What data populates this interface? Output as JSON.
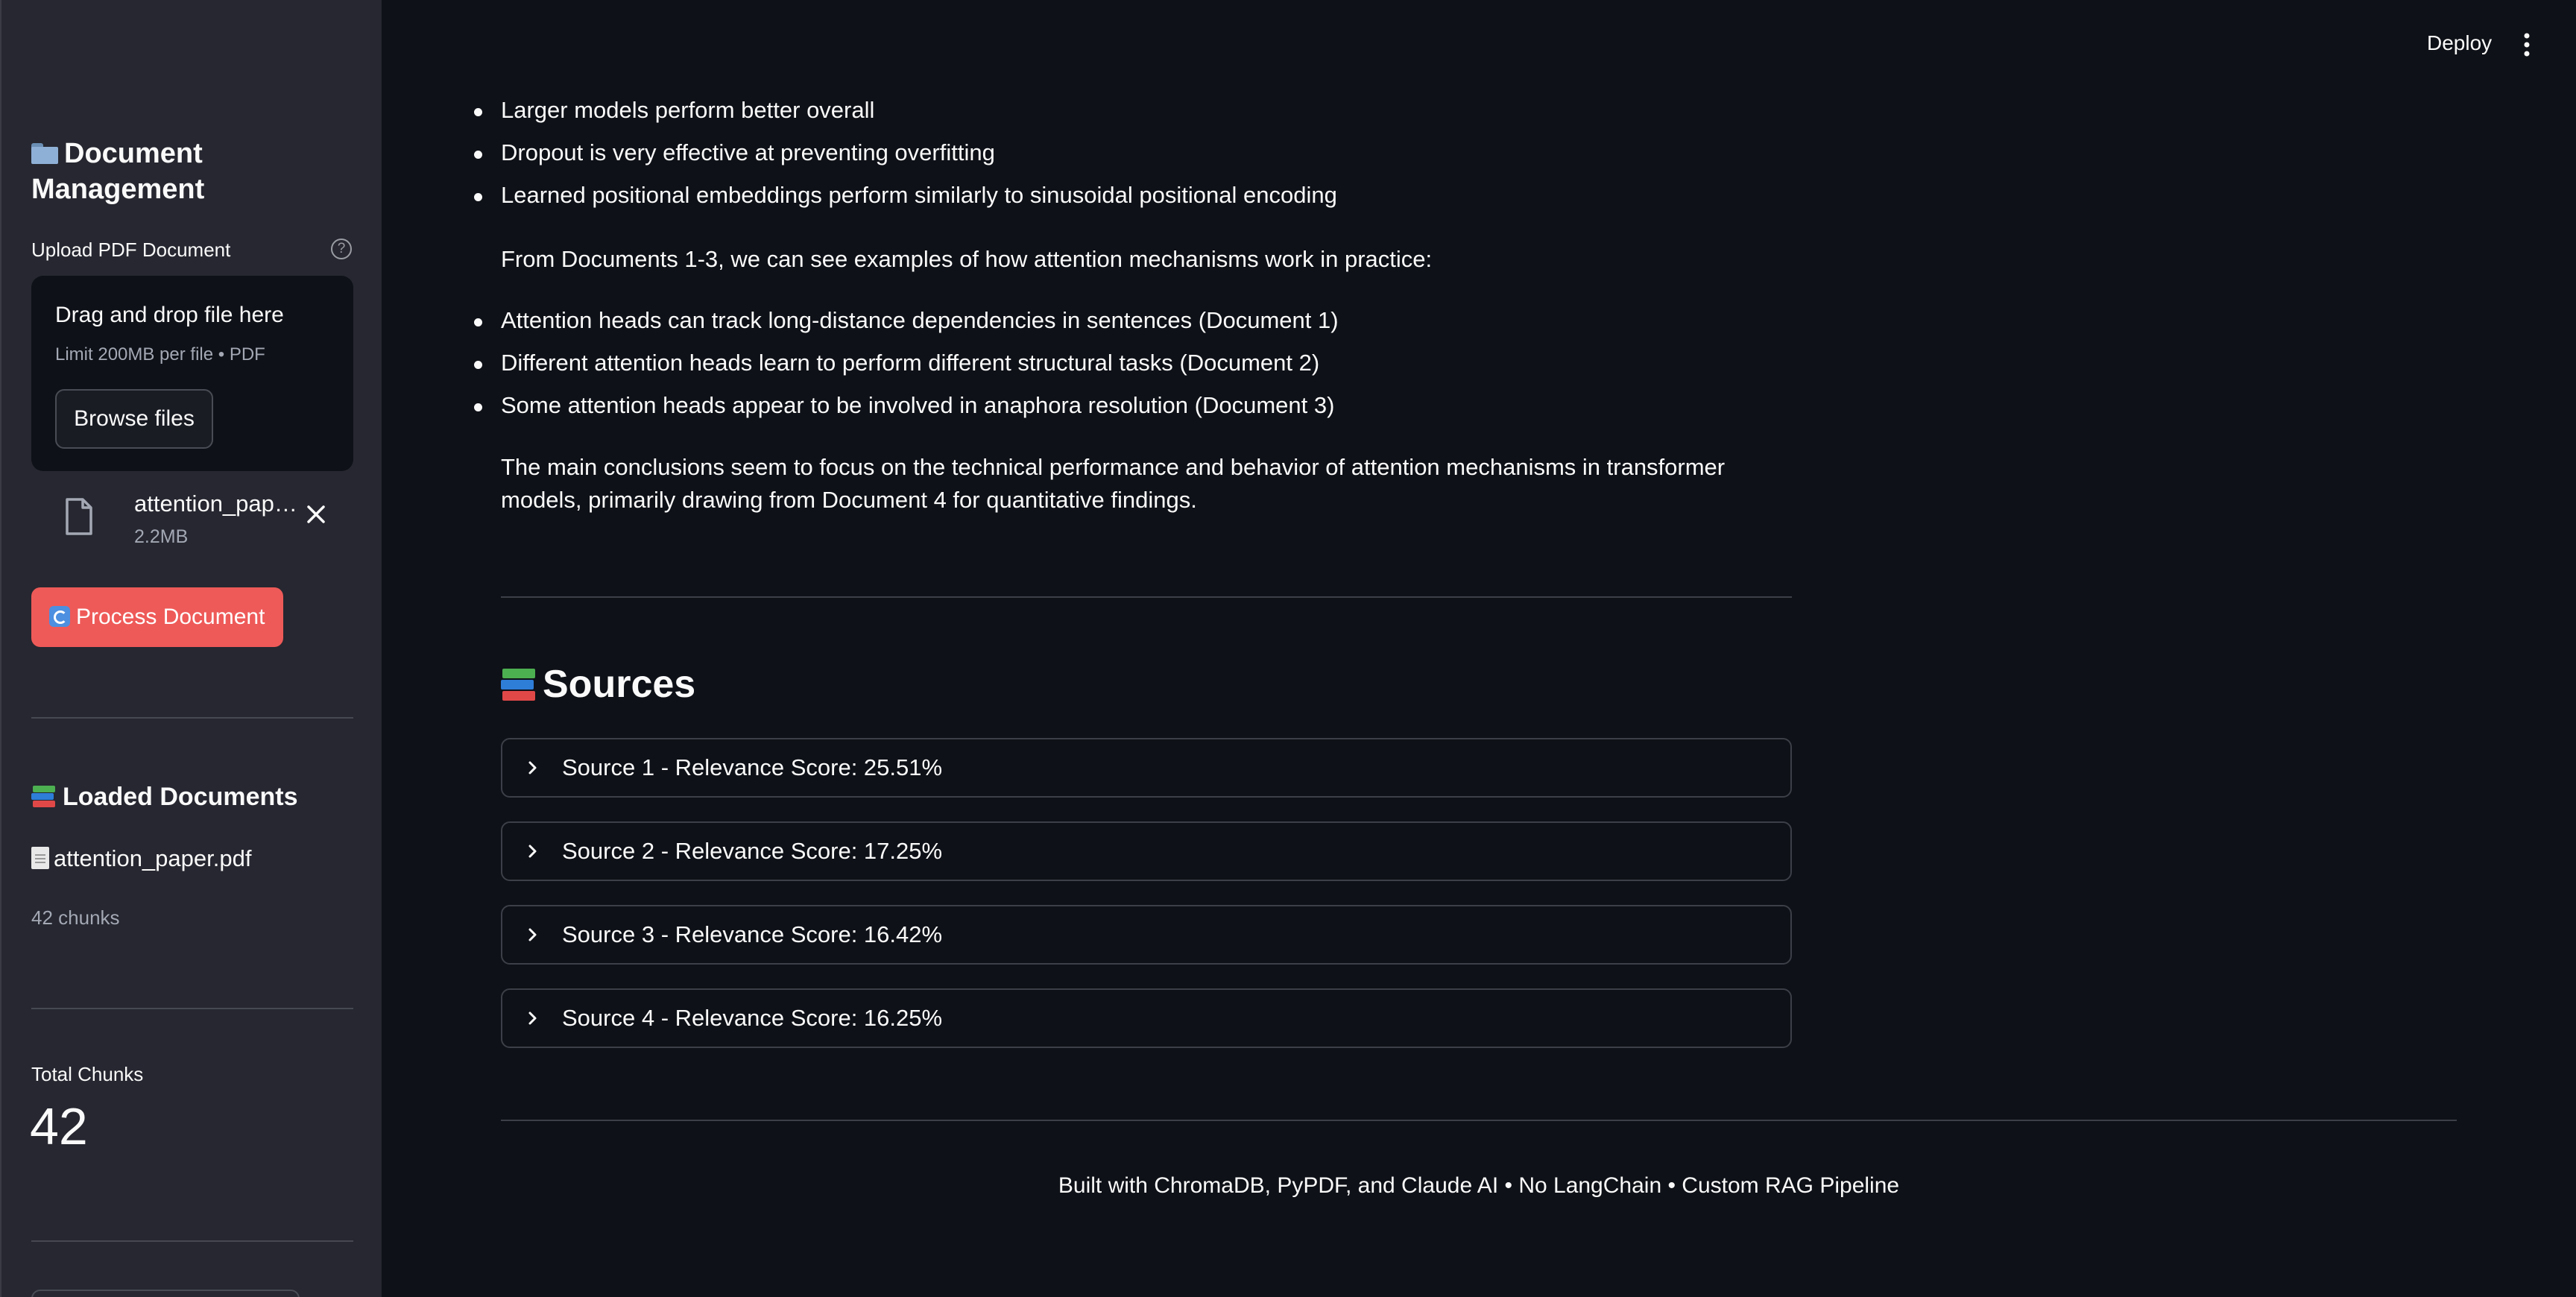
{
  "sidebar": {
    "title": "Document Management",
    "upload_label": "Upload PDF Document",
    "dropzone": {
      "title": "Drag and drop file here",
      "limit": "Limit 200MB per file • PDF",
      "browse_label": "Browse files"
    },
    "uploaded_file": {
      "name": "attention_paper.pdf",
      "size": "2.2MB"
    },
    "process_button_label": "Process Document",
    "loaded_header": "Loaded Documents",
    "loaded_doc_name": "attention_paper.pdf",
    "loaded_doc_chunks": "42 chunks",
    "total_chunks_label": "Total Chunks",
    "total_chunks_value": "42"
  },
  "header": {
    "deploy_label": "Deploy"
  },
  "main": {
    "bullets_top": [
      "Larger models perform better overall",
      "Dropout is very effective at preventing overfitting",
      "Learned positional embeddings perform similarly to sinusoidal positional encoding"
    ],
    "para_1": "From Documents 1-3, we can see examples of how attention mechanisms work in practice:",
    "bullets_mid": [
      "Attention heads can track long-distance dependencies in sentences (Document 1)",
      "Different attention heads learn to perform different structural tasks (Document 2)",
      "Some attention heads appear to be involved in anaphora resolution (Document 3)"
    ],
    "para_2": "The main conclusions seem to focus on the technical performance and behavior of attention mechanisms in transformer models, primarily drawing from Document 4 for quantitative findings.",
    "sources_heading": "Sources",
    "sources": [
      "Source 1 - Relevance Score: 25.51%",
      "Source 2 - Relevance Score: 17.25%",
      "Source 3 - Relevance Score: 16.42%",
      "Source 4 - Relevance Score: 16.25%"
    ]
  },
  "footer": {
    "text": "Built with ChromaDB, PyPDF, and Claude AI • No LangChain • Custom RAG Pipeline"
  },
  "colors": {
    "background": "#0e1117",
    "sidebar": "#262730",
    "primary_button": "#ee5a58",
    "text": "#fafafa",
    "muted_text": "#a3a8b4"
  },
  "icons": [
    "folder-icon",
    "help-icon",
    "file-icon",
    "close-icon",
    "refresh-icon",
    "books-icon",
    "page-icon",
    "kebab-menu-icon",
    "chevron-right-icon"
  ]
}
